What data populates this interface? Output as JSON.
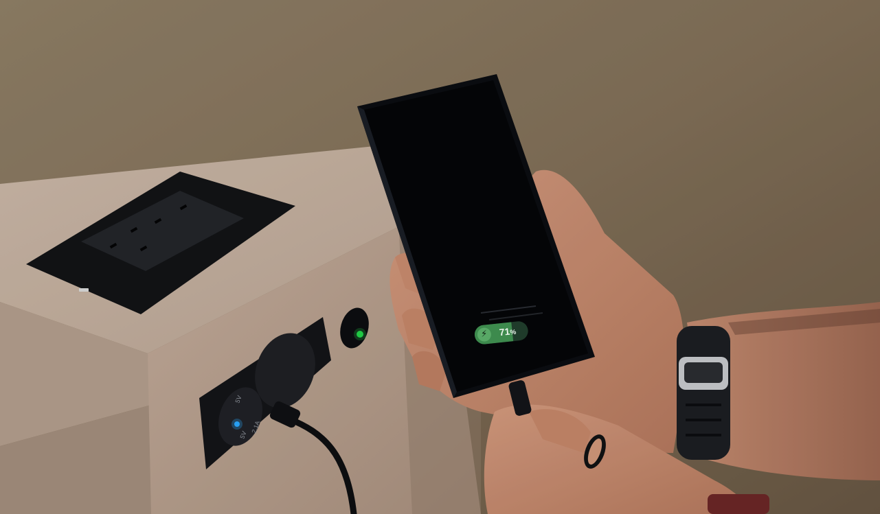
{
  "phone": {
    "battery_percent": 71,
    "battery_number": "71",
    "battery_unit": "%",
    "charging_icon": "lightning-bolt-icon",
    "charge_color": "#3d8a4d"
  },
  "usb_panel": {
    "port_label_1": "5V",
    "port_label_2": "5V",
    "port_label_3": "2.1A",
    "indicator_color": "#2aa8ff"
  },
  "status_light": {
    "color": "#22d448"
  },
  "colors": {
    "wall": "#8d7a62",
    "cabinet": "#c8b3a3",
    "phone_body": "#0b0d11"
  }
}
